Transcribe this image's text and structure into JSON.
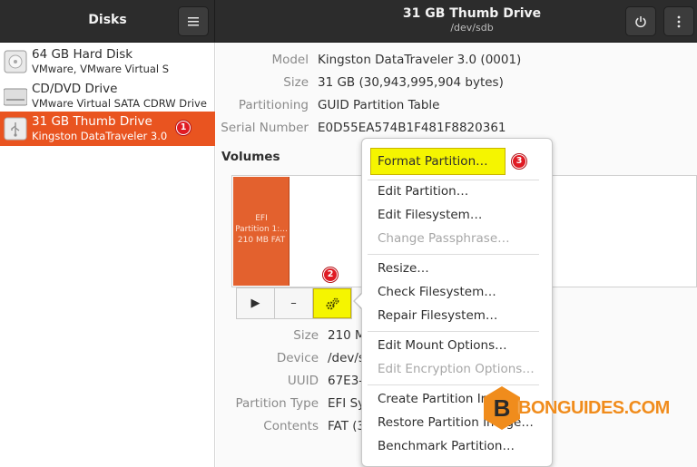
{
  "header": {
    "left_title": "Disks",
    "menu_icon": "hamburger-icon",
    "title": "31 GB Thumb Drive",
    "subtitle": "/dev/sdb",
    "power_icon": "power-icon",
    "more_icon": "vertical-dots-icon"
  },
  "sidebar": {
    "items": [
      {
        "name": "64 GB Hard Disk",
        "desc": "VMware, VMware Virtual S",
        "icon": "hard-disk-icon"
      },
      {
        "name": "CD/DVD Drive",
        "desc": "VMware Virtual SATA CDRW Drive",
        "icon": "optical-drive-icon"
      },
      {
        "name": "31 GB Thumb Drive",
        "desc": "Kingston DataTraveler 3.0",
        "icon": "usb-drive-icon",
        "badge": "1"
      }
    ]
  },
  "drive_props": [
    {
      "label": "Model",
      "value": "Kingston DataTraveler 3.0 (0001)"
    },
    {
      "label": "Size",
      "value": "31 GB (30,943,995,904 bytes)"
    },
    {
      "label": "Partitioning",
      "value": "GUID Partition Table"
    },
    {
      "label": "Serial Number",
      "value": "E0D55EA574B1F481F8820361"
    }
  ],
  "volumes": {
    "title": "Volumes",
    "partition_lines": [
      "EFI",
      "Partition 1:...",
      "210 MB FAT"
    ],
    "tool_play": "▶",
    "tool_minus": "–",
    "gear_badge": "2"
  },
  "volume_props": [
    {
      "label": "Size",
      "value": "210 M"
    },
    {
      "label": "Device",
      "value": "/dev/s"
    },
    {
      "label": "UUID",
      "value": "67E3-"
    },
    {
      "label": "Partition Type",
      "value": "EFI Sy"
    },
    {
      "label": "Contents",
      "value": "FAT (3"
    }
  ],
  "menu": {
    "items": [
      {
        "label": "Format Partition…",
        "disabled": false
      },
      {
        "label": "Edit Partition…",
        "disabled": false
      },
      {
        "label": "Edit Filesystem…",
        "disabled": false
      },
      {
        "label": "Change Passphrase…",
        "disabled": true
      },
      {
        "label": "Resize…",
        "disabled": false
      },
      {
        "label": "Check Filesystem…",
        "disabled": false
      },
      {
        "label": "Repair Filesystem…",
        "disabled": false
      },
      {
        "label": "Edit Mount Options…",
        "disabled": false
      },
      {
        "label": "Edit Encryption Options…",
        "disabled": true
      },
      {
        "label": "Create Partition Image…",
        "disabled": false
      },
      {
        "label": "Restore Partition Image…",
        "disabled": false
      },
      {
        "label": "Benchmark Partition…",
        "disabled": false
      }
    ],
    "format_badge": "3"
  },
  "watermark": {
    "text": "BONGUIDES.COM",
    "logo_letter": "B"
  },
  "colors": {
    "accent": "#e95420",
    "highlight": "#f5f500",
    "badge": "#e01b24",
    "watermark": "#f08c1c"
  }
}
